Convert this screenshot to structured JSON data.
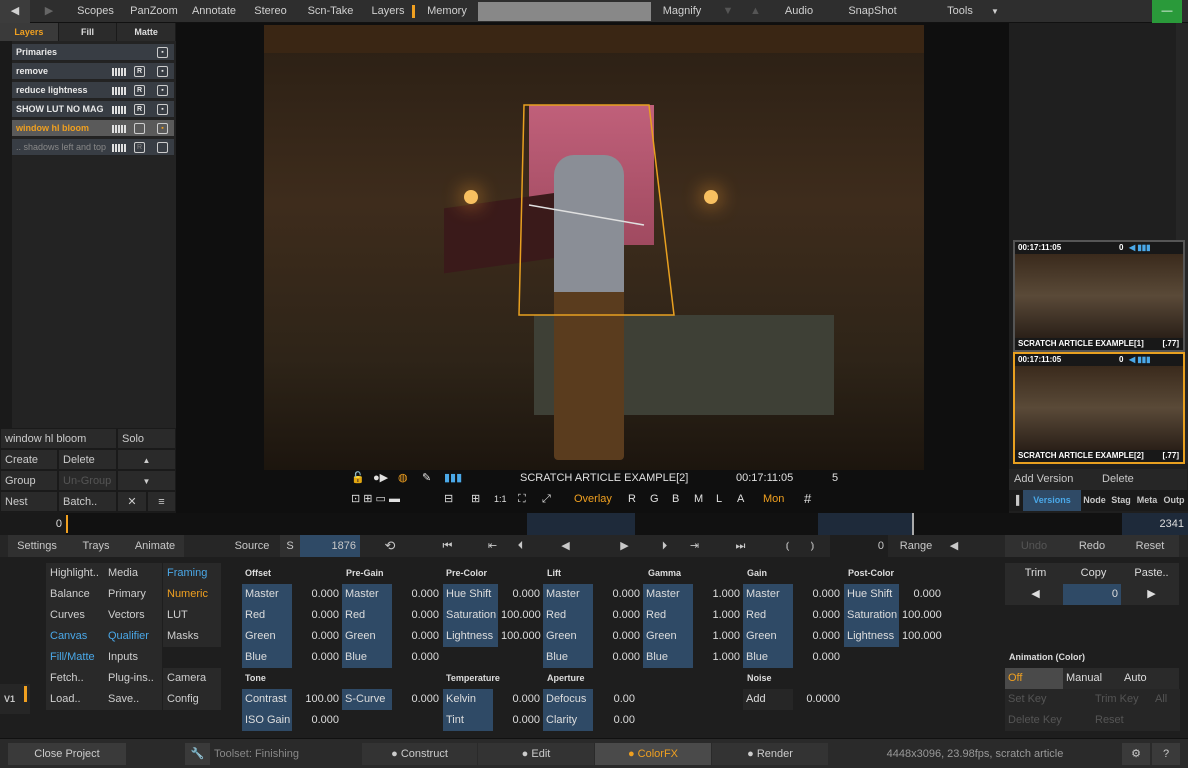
{
  "topbar": {
    "items": [
      "Scopes",
      "PanZoom",
      "Annotate",
      "Stereo",
      "Scn-Take",
      "Layers",
      "Memory",
      "Magnify",
      "Audio",
      "SnapShot",
      "Tools"
    ]
  },
  "left_panel": {
    "tabs": [
      "Layers",
      "Fill",
      "Matte"
    ],
    "layers": [
      {
        "name": "Primaries"
      },
      {
        "name": "remove"
      },
      {
        "name": "reduce lightness"
      },
      {
        "name": "SHOW LUT NO MAG"
      },
      {
        "name": "window hl bloom"
      },
      {
        "name": ".. shadows left and top"
      }
    ],
    "selected_name": "window hl bloom",
    "solo": "Solo",
    "buttons": {
      "create": "Create",
      "delete": "Delete",
      "group": "Group",
      "ungroup": "Un-Group",
      "nest": "Nest",
      "batch": "Batch..",
      "r": "R"
    }
  },
  "viewer": {
    "clip_name": "SCRATCH ARTICLE EXAMPLE[2]",
    "timecode": "00:17:11:05",
    "count": "5",
    "overlay": "Overlay",
    "channels": [
      "R",
      "G",
      "B",
      "M",
      "L",
      "A"
    ],
    "mon": "Mon",
    "hash": "#"
  },
  "right_panel": {
    "thumbs": [
      {
        "tc": "00:17:11:05",
        "zero": "0",
        "name": "SCRATCH ARTICLE EXAMPLE[1]",
        "tag": "[.77]"
      },
      {
        "tc": "00:17:11:05",
        "zero": "0",
        "name": "SCRATCH ARTICLE EXAMPLE[2]",
        "tag": "[.77]"
      }
    ],
    "add_version": "Add Version",
    "delete": "Delete",
    "tabs": [
      "Versions",
      "Node",
      "Stag",
      "Meta",
      "Outp"
    ]
  },
  "timeline": {
    "start": "0",
    "end": "2341"
  },
  "controls": {
    "settings": "Settings",
    "trays": "Trays",
    "animate": "Animate",
    "source": "Source",
    "s": "S",
    "frame": "1876",
    "zero": "0",
    "range": "Range",
    "undo": "Undo",
    "redo": "Redo",
    "reset": "Reset"
  },
  "menu": {
    "col1": [
      "Highlight..",
      "Balance",
      "Curves",
      "Canvas",
      "Fill/Matte",
      "Fetch..",
      "Load.."
    ],
    "col2": [
      "Media",
      "Primary",
      "Vectors",
      "Qualifier",
      "Inputs",
      "Plug-ins..",
      "Save.."
    ],
    "col3": [
      "Framing",
      "Numeric",
      "LUT",
      "Masks",
      "",
      "Camera",
      "Config"
    ],
    "v1": "V1"
  },
  "params": {
    "offset": {
      "title": "Offset",
      "rows": [
        [
          "Master",
          "0.000"
        ],
        [
          "Red",
          "0.000"
        ],
        [
          "Green",
          "0.000"
        ],
        [
          "Blue",
          "0.000"
        ]
      ]
    },
    "pregain": {
      "title": "Pre-Gain",
      "rows": [
        [
          "Master",
          "0.000"
        ],
        [
          "Red",
          "0.000"
        ],
        [
          "Green",
          "0.000"
        ],
        [
          "Blue",
          "0.000"
        ]
      ]
    },
    "precolor": {
      "title": "Pre-Color",
      "rows": [
        [
          "Hue Shift",
          "0.000"
        ],
        [
          "Saturation",
          "100.000"
        ],
        [
          "Lightness",
          "100.000"
        ]
      ]
    },
    "lift": {
      "title": "Lift",
      "rows": [
        [
          "Master",
          "0.000"
        ],
        [
          "Red",
          "0.000"
        ],
        [
          "Green",
          "0.000"
        ],
        [
          "Blue",
          "0.000"
        ]
      ]
    },
    "gamma": {
      "title": "Gamma",
      "rows": [
        [
          "Master",
          "1.000"
        ],
        [
          "Red",
          "1.000"
        ],
        [
          "Green",
          "1.000"
        ],
        [
          "Blue",
          "1.000"
        ]
      ]
    },
    "gain": {
      "title": "Gain",
      "rows": [
        [
          "Master",
          "0.000"
        ],
        [
          "Red",
          "0.000"
        ],
        [
          "Green",
          "0.000"
        ],
        [
          "Blue",
          "0.000"
        ]
      ]
    },
    "postcolor": {
      "title": "Post-Color",
      "rows": [
        [
          "Hue Shift",
          "0.000"
        ],
        [
          "Saturation",
          "100.000"
        ],
        [
          "Lightness",
          "100.000"
        ]
      ]
    },
    "tone": {
      "title": "Tone",
      "rows": [
        [
          "Contrast",
          "100.00"
        ],
        [
          "ISO Gain",
          "0.000"
        ]
      ]
    },
    "scurve": {
      "label": "S-Curve",
      "value": "0.000"
    },
    "temperature": {
      "title": "Temperature",
      "rows": [
        [
          "Kelvin",
          "0.000"
        ],
        [
          "Tint",
          "0.000"
        ]
      ]
    },
    "aperture": {
      "title": "Aperture",
      "rows": [
        [
          "Defocus",
          "0.00"
        ],
        [
          "Clarity",
          "0.00"
        ]
      ]
    },
    "noise": {
      "title": "Noise",
      "rows": [
        [
          "Add",
          "0.0000"
        ]
      ]
    }
  },
  "right_tools": {
    "trim": "Trim",
    "copy": "Copy",
    "paste": "Paste..",
    "copy_val": "0",
    "anim_title": "Animation (Color)",
    "off": "Off",
    "manual": "Manual",
    "auto": "Auto",
    "setkey": "Set Key",
    "trimkey": "Trim Key",
    "all": "All",
    "deletekey": "Delete Key",
    "reset": "Reset"
  },
  "statusbar": {
    "close": "Close Project",
    "toolset": "Toolset: Finishing",
    "construct": "Construct",
    "edit": "Edit",
    "colorfx": "ColorFX",
    "render": "Render",
    "info": "4448x3096, 23.98fps, scratch article",
    "help": "?"
  }
}
